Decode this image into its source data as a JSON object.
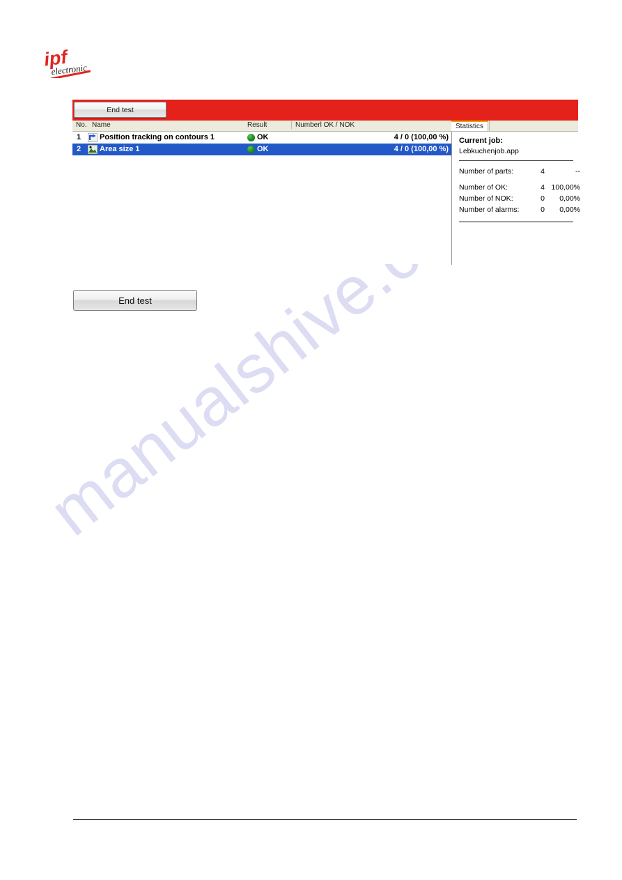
{
  "brand": {
    "name": "ipf",
    "tagline": "electronic",
    "color": "#e5211b"
  },
  "window": {
    "titlebar_color": "#e5211b",
    "end_test_label": "End test"
  },
  "table": {
    "columns": [
      "No.",
      "Name",
      "Result",
      "Numberl OK / NOK"
    ],
    "rows": [
      {
        "no": "1",
        "icon": "position-tracking-icon",
        "name": "Position tracking on contours 1",
        "result": "OK",
        "result_state": "ok",
        "number": "4 / 0 (100,00 %)",
        "selected": false
      },
      {
        "no": "2",
        "icon": "area-size-icon",
        "name": "Area size 1",
        "result": "OK",
        "result_state": "ok",
        "number": "4 / 0 (100,00 %)",
        "selected": true
      }
    ]
  },
  "statistics": {
    "tab_label": "Statistics",
    "current_job_label": "Current job:",
    "current_job_value": "Lebkuchenjob.app",
    "metrics": [
      {
        "label": "Number of parts:",
        "count": "4",
        "percent": "--"
      },
      {
        "label": "Number of OK:",
        "count": "4",
        "percent": "100,00%"
      },
      {
        "label": "Number of NOK:",
        "count": "0",
        "percent": "0,00%"
      },
      {
        "label": "Number of alarms:",
        "count": "0",
        "percent": "0,00%"
      }
    ]
  },
  "actions": {
    "end_test_large_label": "End test"
  },
  "watermark": {
    "text": "manualshive.com"
  }
}
